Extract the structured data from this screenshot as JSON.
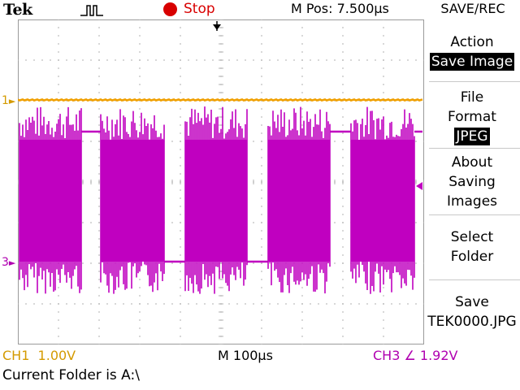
{
  "header": {
    "brand": "Tek",
    "run_state": "Stop",
    "horizontal_position": "M Pos: 7.500µs",
    "menu_title": "SAVE/REC"
  },
  "side_menu": {
    "action": {
      "label": "Action",
      "value": "Save Image"
    },
    "file_format": {
      "label_line1": "File",
      "label_line2": "Format",
      "value": "JPEG"
    },
    "about": {
      "line1": "About",
      "line2": "Saving",
      "line3": "Images"
    },
    "select_folder": {
      "line1": "Select",
      "line2": "Folder"
    },
    "save": {
      "line1": "Save",
      "line2": "TEK0000.JPG"
    }
  },
  "graticule": {
    "ch1_marker": "1",
    "ch3_marker": "3"
  },
  "status": {
    "ch1": "CH1  1.00V",
    "timebase": "M 100µs",
    "trigger": "CH3 ∠ 1.92V",
    "folder": "Current Folder is A:\\"
  },
  "colors": {
    "ch1": "#f0a000",
    "ch3": "#c000c0",
    "stop": "#d80000",
    "grid": "#b0b0b0"
  }
}
